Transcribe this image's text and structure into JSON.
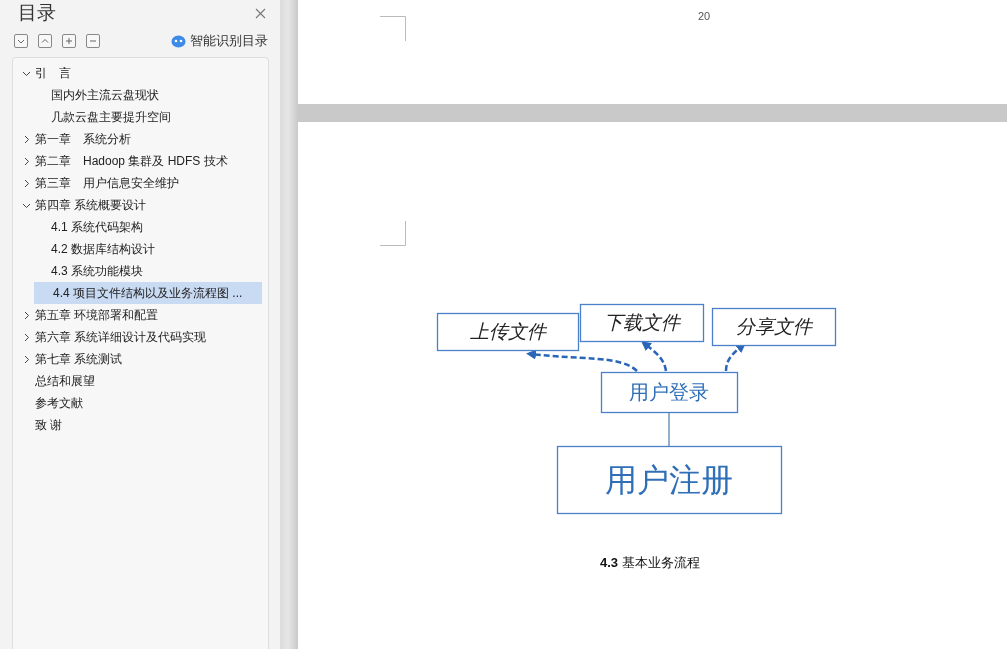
{
  "sidebar": {
    "title": "目录",
    "toolbar_buttons": [
      {
        "kind": "expand"
      },
      {
        "kind": "collapse"
      },
      {
        "kind": "plus"
      },
      {
        "kind": "minus"
      }
    ],
    "smart_button": "智能识别目录",
    "toc": [
      {
        "label": "引　言",
        "expanded": true,
        "selected": false,
        "children": [
          {
            "label": "国内外主流云盘现状",
            "selected": false
          },
          {
            "label": "几款云盘主要提升空间",
            "selected": false
          }
        ]
      },
      {
        "label": "第一章　系统分析",
        "expanded": false,
        "selected": false
      },
      {
        "label": "第二章　Hadoop 集群及 HDFS 技术",
        "expanded": false,
        "selected": false
      },
      {
        "label": "第三章　用户信息安全维护",
        "expanded": false,
        "selected": false
      },
      {
        "label": "第四章 系统概要设计",
        "expanded": true,
        "selected": false,
        "children": [
          {
            "label": "4.1 系统代码架构",
            "selected": false
          },
          {
            "label": "4.2 数据库结构设计",
            "selected": false
          },
          {
            "label": "4.3  系统功能模块",
            "selected": false
          },
          {
            "label": "4.4  项目文件结构以及业务流程图 ...",
            "selected": true
          }
        ]
      },
      {
        "label": "第五章 环境部署和配置",
        "expanded": false,
        "selected": false
      },
      {
        "label": "第六章 系统详细设计及代码实现",
        "expanded": false,
        "selected": false
      },
      {
        "label": "第七章 系统测试",
        "expanded": false,
        "selected": false
      },
      {
        "label": "总结和展望",
        "selected": false
      },
      {
        "label": "参考文献",
        "selected": false
      },
      {
        "label": "致 谢",
        "selected": false
      }
    ]
  },
  "document": {
    "page_number": "20",
    "figure": {
      "nodes": [
        {
          "label": "上传文件",
          "kind": "action"
        },
        {
          "label": "下载文件",
          "kind": "action"
        },
        {
          "label": "分享文件",
          "kind": "action"
        },
        {
          "label": "用户登录",
          "kind": "login"
        },
        {
          "label": "用户注册",
          "kind": "register"
        }
      ],
      "caption": "**4.3** 基本业务流程"
    }
  }
}
